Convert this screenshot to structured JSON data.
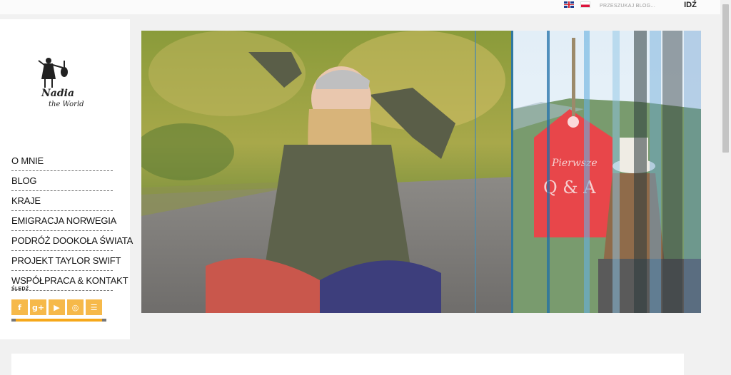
{
  "header": {
    "search_placeholder": "PRZESZUKAJ BLOG...",
    "go_label": "IDŹ",
    "languages": [
      "english-flag",
      "polish-flag"
    ]
  },
  "logo": {
    "text_line1": "Nadia",
    "text_line2": "the World"
  },
  "menu": {
    "items": [
      {
        "label": "O MNIE"
      },
      {
        "label": "BLOG"
      },
      {
        "label": "KRAJE"
      },
      {
        "label": "EMIGRACJA NORWEGIA"
      },
      {
        "label": "PODRÓŻ DOOKOŁA ŚWIATA"
      },
      {
        "label": "PROJEKT TAYLOR SWIFT"
      },
      {
        "label": "WSPÓŁPRACA & KONTAKT"
      }
    ]
  },
  "follow": {
    "label": "ŚLEDŹ",
    "icons": [
      "facebook-icon",
      "google-plus-icon",
      "youtube-icon",
      "instagram-icon",
      "rss-icon"
    ],
    "glyphs": [
      "f",
      "g+",
      "▶",
      "◎",
      "☰"
    ]
  },
  "hero": {
    "tag_line1": "Pierwsze",
    "tag_line2": "Q & A"
  },
  "colors": {
    "accent": "#f6b94a",
    "accent_bar": "#f6a81b",
    "tag_red": "#e8464a"
  }
}
